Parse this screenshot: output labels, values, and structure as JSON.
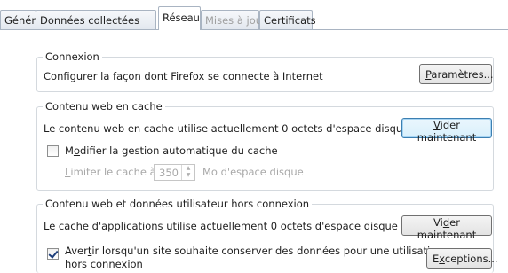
{
  "tabs": [
    {
      "label": "Général",
      "state": "normal"
    },
    {
      "label": "Données collectées",
      "state": "normal"
    },
    {
      "label": "Réseau",
      "state": "active"
    },
    {
      "label": "Mises à jour",
      "state": "disabled"
    },
    {
      "label": "Certificats",
      "state": "normal"
    }
  ],
  "connexion": {
    "legend": "Connexion",
    "text": "Configurer la façon dont Firefox se connecte à Internet",
    "button_mnemonic": "P",
    "button_rest": "aramètres..."
  },
  "cache": {
    "legend": "Contenu web en cache",
    "text": "Le contenu web en cache utilise actuellement 0 octets d'espace disque",
    "clear_mnemonic": "V",
    "clear_rest": "ider maintenant",
    "override_pre": "M",
    "override_mnemonic": "o",
    "override_rest": "difier la gestion automatique du cache",
    "override_checked": false,
    "limit_mnemonic": "L",
    "limit_rest": "imiter le cache à",
    "limit_value": "350",
    "limit_unit": "Mo d'espace disque"
  },
  "offline": {
    "legend": "Contenu web et données utilisateur hors connexion",
    "text": "Le cache d'applications utilise actuellement 0 octets d'espace disque",
    "clear_pre": "Vi",
    "clear_mnemonic": "d",
    "clear_rest": "er maintenant",
    "warn_pre": "Aver",
    "warn_mnemonic": "t",
    "warn_rest": "ir lorsqu'un site souhaite conserver des données pour une utilisation",
    "warn_line2": "hors connexion",
    "warn_checked": true,
    "exceptions_pre": "E",
    "exceptions_mnemonic": "x",
    "exceptions_rest": "ceptions..."
  },
  "colors": {
    "tab_border": "#a9b4c2",
    "group_border": "#d4d9de",
    "disabled_text": "#a8a8a8",
    "focus_border": "#3c7fb1"
  }
}
